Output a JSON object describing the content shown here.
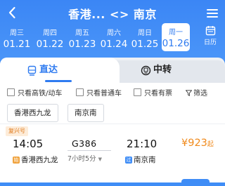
{
  "header": {
    "title": "香港... <> 南京"
  },
  "dates": [
    {
      "weekday": "周三",
      "date": "01.21",
      "selected": false
    },
    {
      "weekday": "周四",
      "date": "01.22",
      "selected": false
    },
    {
      "weekday": "周五",
      "date": "01.23",
      "selected": false
    },
    {
      "weekday": "周六",
      "date": "01.24",
      "selected": false
    },
    {
      "weekday": "周日",
      "date": "01.25",
      "selected": false
    },
    {
      "weekday": "周一",
      "date": "01.26",
      "selected": true
    }
  ],
  "calendar_label": "日历",
  "tabs": {
    "direct": "直达",
    "transfer": "中转"
  },
  "filters": {
    "high_speed": "只看高铁/动车",
    "normal": "只看普通车",
    "available": "只看有票",
    "filter": "筛选"
  },
  "stations": {
    "from": "香港西九龙",
    "to": "南京南"
  },
  "train": {
    "badge": "复兴号",
    "depart_time": "14:05",
    "number": "G386",
    "arrive_time": "21:10",
    "duration": "7小时5分",
    "price": "¥923",
    "price_suffix": "起",
    "depart_station": "香港西九龙",
    "depart_station_tag": "始",
    "arrive_station": "南京南",
    "arrive_station_tag": "过"
  },
  "colors": {
    "brand_blue": "#3f8df6",
    "price_orange": "#f08a1c",
    "start_tag": "#f0a23c",
    "pass_tag": "#3f8df6"
  }
}
